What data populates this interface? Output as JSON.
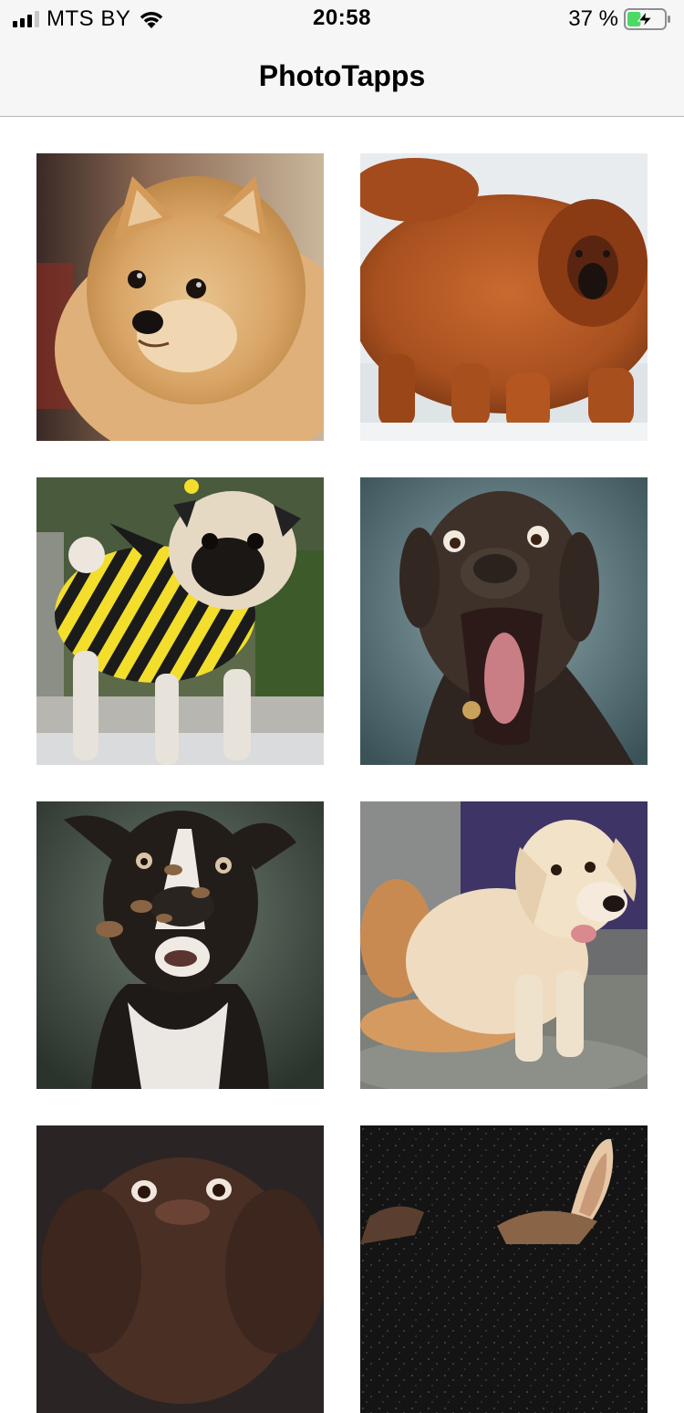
{
  "status_bar": {
    "carrier": "MTS BY",
    "time": "20:58",
    "battery_percent": "37 %",
    "battery_level": 0.37,
    "charging": true,
    "signal_bars_filled": 3,
    "signal_bars_total": 4
  },
  "nav": {
    "title": "PhotoTapps"
  },
  "photos": [
    {
      "icon": "pomeranian-photo"
    },
    {
      "icon": "tibetan-mastiff-photo"
    },
    {
      "icon": "pug-bee-costume-photo"
    },
    {
      "icon": "surprised-brown-dog-photo"
    },
    {
      "icon": "dog-catching-treats-photo"
    },
    {
      "icon": "labrador-sitting-on-cat-photo"
    },
    {
      "icon": "brown-spaniel-photo"
    },
    {
      "icon": "dog-ear-photo"
    }
  ],
  "colors": {
    "bar_background": "#f6f6f6",
    "separator": "#b8b8bc",
    "battery_fill": "#4cd964"
  }
}
